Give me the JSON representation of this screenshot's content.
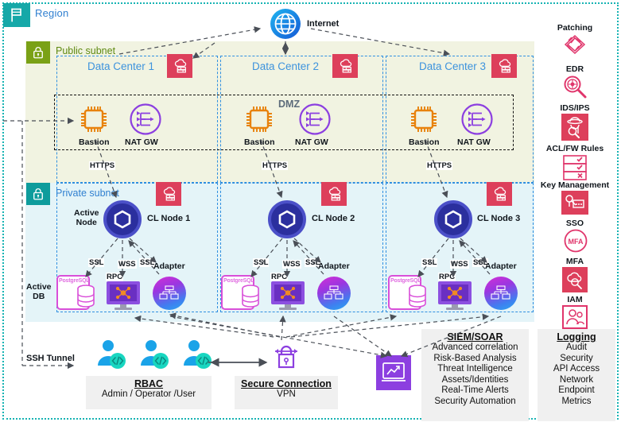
{
  "region": {
    "label": "Region",
    "icon": "flag-icon"
  },
  "subnets": {
    "public": {
      "label": "Public subnet",
      "icon": "lock-icon",
      "color": "#7aa116"
    },
    "private": {
      "label": "Private subnet",
      "icon": "lock-icon",
      "color": "#0e9c9c"
    }
  },
  "internet": {
    "label": "Internet",
    "icon": "globe-icon"
  },
  "dmz": {
    "label": "DMZ"
  },
  "datacenters": [
    {
      "title": "Data Center 1",
      "bastion": "Bastion",
      "nat": "NAT GW",
      "https": "HTTPS",
      "node": "CL Node 1",
      "node_tag": "Active\nNode",
      "db_tag": "Active\nDB",
      "ssl_left": "SSL",
      "wss": "WSS",
      "rpc": "RPC",
      "ssl_right": "SSL",
      "adapter": "Adapter",
      "db": "PostgreSQL"
    },
    {
      "title": "Data Center 2",
      "bastion": "Bastion",
      "nat": "NAT GW",
      "https": "HTTPS",
      "node": "CL Node 2",
      "node_tag": "",
      "db_tag": "",
      "ssl_left": "SSL",
      "wss": "WSS",
      "rpc": "RPC",
      "ssl_right": "SSL",
      "adapter": "Adapter",
      "db": "PostgreSQL"
    },
    {
      "title": "Data Center 3",
      "bastion": "Bastion",
      "nat": "NAT GW",
      "https": "HTTPS",
      "node": "CL Node 3",
      "node_tag": "",
      "db_tag": "",
      "ssl_left": "SSL",
      "wss": "WSS",
      "rpc": "RPC",
      "ssl_right": "SSL",
      "adapter": "Adapter",
      "db": "PostgreSQL"
    }
  ],
  "security_stack": [
    {
      "label": "Patching",
      "icon": "patching-icon"
    },
    {
      "label": "EDR",
      "icon": "edr-magnifier-icon"
    },
    {
      "label": "IDS/IPS",
      "icon": "ids-ips-detective-icon"
    },
    {
      "label": "ACL/FW Rules",
      "icon": "acl-rules-list-icon"
    },
    {
      "label": "Key Management",
      "icon": "key-management-icon"
    },
    {
      "label": "SSO",
      "icon": "sso-mfa-circle-icon"
    },
    {
      "label": "MFA",
      "icon": "mfa-cloud-key-icon"
    },
    {
      "label": "IAM",
      "icon": "iam-users-icon"
    }
  ],
  "bottom": {
    "ssh_tunnel": "SSH Tunnel",
    "rbac": {
      "title": "RBAC",
      "subtitle": "Admin / Operator /User",
      "icon": "user-dev-icon"
    },
    "vpn": {
      "title": "Secure Connection",
      "subtitle": "VPN",
      "icon": "vpn-lock-icon"
    },
    "monitoring_icon": "monitoring-chart-icon",
    "siem": {
      "title": "SIEM/SOAR",
      "items": [
        "Advanced correlation",
        "Risk-Based Analysis",
        "Threat Intelligence",
        "Assets/Identities",
        "Real-Time Alerts",
        "Security Automation"
      ]
    },
    "logging": {
      "title": "Logging",
      "items": [
        "Audit",
        "Security",
        "API Access",
        "Network",
        "Endpoint",
        "Metrics"
      ]
    }
  },
  "colors": {
    "region_border": "#17b3b3",
    "public_bg": "#f1f3e1",
    "private_bg": "#e4f4f8",
    "dc_border": "#2f8fe0",
    "aws_red": "#dd3f5b",
    "node_blue": "#2b2f9e",
    "postgres": "#d94fd9",
    "purple": "#8c4fe0",
    "teal": "#0e9c9c"
  }
}
